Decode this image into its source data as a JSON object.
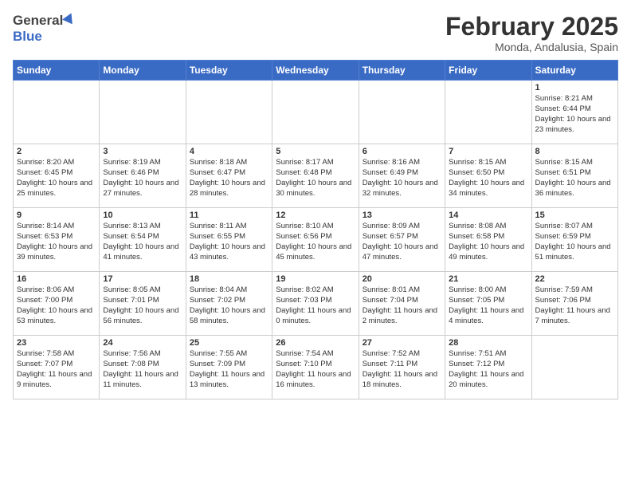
{
  "header": {
    "logo_general": "General",
    "logo_blue": "Blue",
    "title": "February 2025",
    "subtitle": "Monda, Andalusia, Spain"
  },
  "weekdays": [
    "Sunday",
    "Monday",
    "Tuesday",
    "Wednesday",
    "Thursday",
    "Friday",
    "Saturday"
  ],
  "weeks": [
    [
      {
        "day": "",
        "info": ""
      },
      {
        "day": "",
        "info": ""
      },
      {
        "day": "",
        "info": ""
      },
      {
        "day": "",
        "info": ""
      },
      {
        "day": "",
        "info": ""
      },
      {
        "day": "",
        "info": ""
      },
      {
        "day": "1",
        "info": "Sunrise: 8:21 AM\nSunset: 6:44 PM\nDaylight: 10 hours and 23 minutes."
      }
    ],
    [
      {
        "day": "2",
        "info": "Sunrise: 8:20 AM\nSunset: 6:45 PM\nDaylight: 10 hours and 25 minutes."
      },
      {
        "day": "3",
        "info": "Sunrise: 8:19 AM\nSunset: 6:46 PM\nDaylight: 10 hours and 27 minutes."
      },
      {
        "day": "4",
        "info": "Sunrise: 8:18 AM\nSunset: 6:47 PM\nDaylight: 10 hours and 28 minutes."
      },
      {
        "day": "5",
        "info": "Sunrise: 8:17 AM\nSunset: 6:48 PM\nDaylight: 10 hours and 30 minutes."
      },
      {
        "day": "6",
        "info": "Sunrise: 8:16 AM\nSunset: 6:49 PM\nDaylight: 10 hours and 32 minutes."
      },
      {
        "day": "7",
        "info": "Sunrise: 8:15 AM\nSunset: 6:50 PM\nDaylight: 10 hours and 34 minutes."
      },
      {
        "day": "8",
        "info": "Sunrise: 8:15 AM\nSunset: 6:51 PM\nDaylight: 10 hours and 36 minutes."
      }
    ],
    [
      {
        "day": "9",
        "info": "Sunrise: 8:14 AM\nSunset: 6:53 PM\nDaylight: 10 hours and 39 minutes."
      },
      {
        "day": "10",
        "info": "Sunrise: 8:13 AM\nSunset: 6:54 PM\nDaylight: 10 hours and 41 minutes."
      },
      {
        "day": "11",
        "info": "Sunrise: 8:11 AM\nSunset: 6:55 PM\nDaylight: 10 hours and 43 minutes."
      },
      {
        "day": "12",
        "info": "Sunrise: 8:10 AM\nSunset: 6:56 PM\nDaylight: 10 hours and 45 minutes."
      },
      {
        "day": "13",
        "info": "Sunrise: 8:09 AM\nSunset: 6:57 PM\nDaylight: 10 hours and 47 minutes."
      },
      {
        "day": "14",
        "info": "Sunrise: 8:08 AM\nSunset: 6:58 PM\nDaylight: 10 hours and 49 minutes."
      },
      {
        "day": "15",
        "info": "Sunrise: 8:07 AM\nSunset: 6:59 PM\nDaylight: 10 hours and 51 minutes."
      }
    ],
    [
      {
        "day": "16",
        "info": "Sunrise: 8:06 AM\nSunset: 7:00 PM\nDaylight: 10 hours and 53 minutes."
      },
      {
        "day": "17",
        "info": "Sunrise: 8:05 AM\nSunset: 7:01 PM\nDaylight: 10 hours and 56 minutes."
      },
      {
        "day": "18",
        "info": "Sunrise: 8:04 AM\nSunset: 7:02 PM\nDaylight: 10 hours and 58 minutes."
      },
      {
        "day": "19",
        "info": "Sunrise: 8:02 AM\nSunset: 7:03 PM\nDaylight: 11 hours and 0 minutes."
      },
      {
        "day": "20",
        "info": "Sunrise: 8:01 AM\nSunset: 7:04 PM\nDaylight: 11 hours and 2 minutes."
      },
      {
        "day": "21",
        "info": "Sunrise: 8:00 AM\nSunset: 7:05 PM\nDaylight: 11 hours and 4 minutes."
      },
      {
        "day": "22",
        "info": "Sunrise: 7:59 AM\nSunset: 7:06 PM\nDaylight: 11 hours and 7 minutes."
      }
    ],
    [
      {
        "day": "23",
        "info": "Sunrise: 7:58 AM\nSunset: 7:07 PM\nDaylight: 11 hours and 9 minutes."
      },
      {
        "day": "24",
        "info": "Sunrise: 7:56 AM\nSunset: 7:08 PM\nDaylight: 11 hours and 11 minutes."
      },
      {
        "day": "25",
        "info": "Sunrise: 7:55 AM\nSunset: 7:09 PM\nDaylight: 11 hours and 13 minutes."
      },
      {
        "day": "26",
        "info": "Sunrise: 7:54 AM\nSunset: 7:10 PM\nDaylight: 11 hours and 16 minutes."
      },
      {
        "day": "27",
        "info": "Sunrise: 7:52 AM\nSunset: 7:11 PM\nDaylight: 11 hours and 18 minutes."
      },
      {
        "day": "28",
        "info": "Sunrise: 7:51 AM\nSunset: 7:12 PM\nDaylight: 11 hours and 20 minutes."
      },
      {
        "day": "",
        "info": ""
      }
    ]
  ]
}
